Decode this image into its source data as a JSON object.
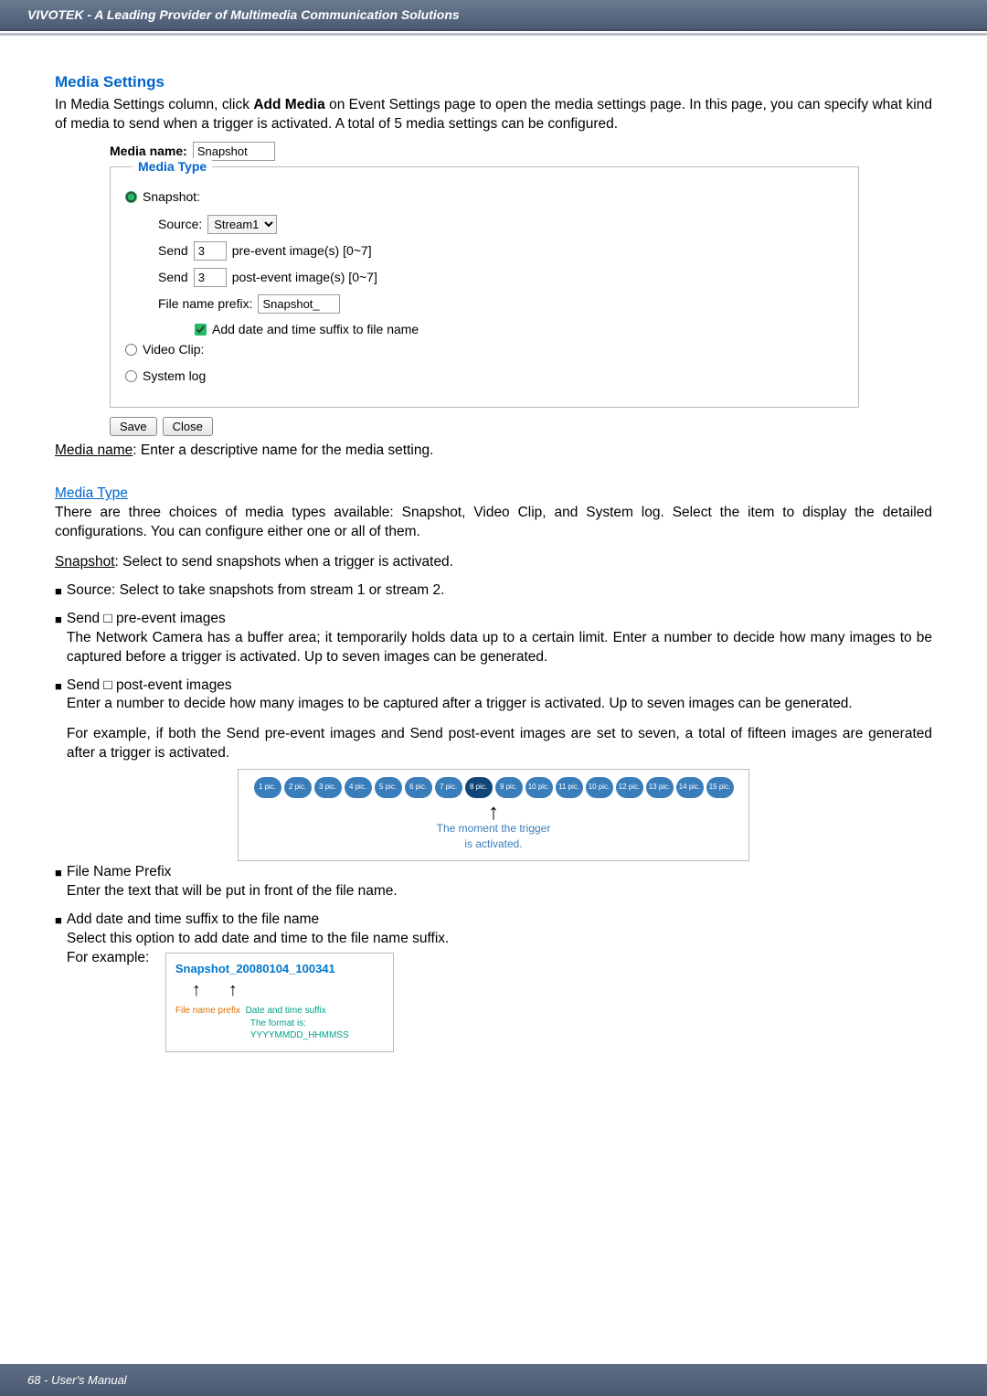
{
  "header": {
    "brand": "VIVOTEK - A Leading Provider of Multimedia Communication Solutions"
  },
  "section": {
    "title": "Media Settings",
    "intro_1": "In Media Settings column, click ",
    "intro_bold": "Add Media",
    "intro_2": " on Event Settings page to open the media settings page. In this page, you can specify what kind of media to send when a trigger is activated. A total of 5 media settings can be configured."
  },
  "form": {
    "media_name_label": "Media name:",
    "media_name_value": "Snapshot",
    "legend": "Media Type",
    "radio_snapshot": "Snapshot:",
    "source_label": "Source:",
    "source_options": [
      "Stream1"
    ],
    "send1_label": "Send",
    "send1_value": "3",
    "send1_suffix": "pre-event image(s) [0~7]",
    "send2_label": "Send",
    "send2_value": "3",
    "send2_suffix": "post-event image(s) [0~7]",
    "prefix_label": "File name prefix:",
    "prefix_value": "Snapshot_",
    "checkbox_label": "Add date and time suffix to file name",
    "radio_videoclip": "Video Clip:",
    "radio_syslog": "System log",
    "save_label": "Save",
    "close_label": "Close"
  },
  "body": {
    "media_name_heading": "Media name",
    "media_name_text": ": Enter a descriptive name for the media setting.",
    "media_type_heading": "Media Type",
    "media_type_text": "There are three choices of media types available: Snapshot, Video Clip, and System log. Select the item to display the detailed configurations. You can configure either one or all of them.",
    "snapshot_heading": "Snapshot",
    "snapshot_text": ": Select to send snapshots when a trigger is activated.",
    "source_bullet": "Source: Select to take snapshots from stream 1 or stream 2.",
    "pre_bullet_head": "Send □ pre-event images",
    "pre_bullet_body": "The Network Camera has a buffer area; it temporarily holds data up to a certain limit. Enter a number to decide how many images to be captured before a trigger is activated. Up to seven images can be generated.",
    "post_bullet_head": "Send □ post-event images",
    "post_bullet_body": "Enter a number to decide how many images to be captured after a trigger is activated. Up to seven images can be generated.",
    "example_text": "For example, if both the Send pre-event images and Send post-event images are set to seven, a total of fifteen images are generated after a trigger is activated.",
    "diagram_caption_1": "The moment the trigger",
    "diagram_caption_2": "is activated.",
    "filename_head": "File Name Prefix",
    "filename_body": "Enter the text that will be put in front of the file name.",
    "adddate_head": "Add date and time suffix to the file name",
    "adddate_body": "Select this option to add date and time to the file name suffix.",
    "for_example": "For example:",
    "example_filename": "Snapshot_20080104_100341",
    "file_name_prefix_label": "File name prefix",
    "date_suffix_label": "Date and time suffix",
    "format_label": "The format is: YYYYMMDD_HHMMSS"
  },
  "diagram": {
    "pics": [
      "1 pic.",
      "2 pic.",
      "3 pic.",
      "4 pic.",
      "5 pic.",
      "6 pic.",
      "7 pic.",
      "8 pic.",
      "9 pic.",
      "10 pic.",
      "11 pic.",
      "10 pic.",
      "12 pic.",
      "13 pic.",
      "14 pic.",
      "15 pic."
    ]
  },
  "footer": {
    "text": "68 - User's Manual"
  }
}
